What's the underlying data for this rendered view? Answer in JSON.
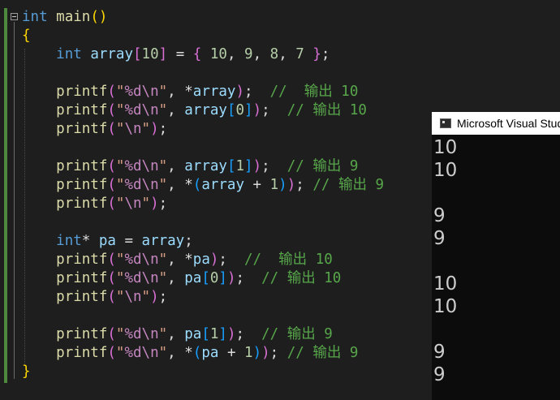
{
  "editor": {
    "code_lines": [
      [
        {
          "t": "int",
          "c": "kw"
        },
        {
          "t": " ",
          "c": "op"
        },
        {
          "t": "main",
          "c": "fn"
        },
        {
          "t": "()",
          "c": "p1"
        }
      ],
      [
        {
          "t": "{",
          "c": "p1"
        }
      ],
      [
        {
          "t": "    ",
          "c": "op"
        },
        {
          "t": "int",
          "c": "kw"
        },
        {
          "t": " ",
          "c": "op"
        },
        {
          "t": "array",
          "c": "var"
        },
        {
          "t": "[",
          "c": "p2"
        },
        {
          "t": "10",
          "c": "num"
        },
        {
          "t": "]",
          "c": "p2"
        },
        {
          "t": " = ",
          "c": "op"
        },
        {
          "t": "{",
          "c": "p2"
        },
        {
          "t": " ",
          "c": "op"
        },
        {
          "t": "10",
          "c": "num"
        },
        {
          "t": ", ",
          "c": "op"
        },
        {
          "t": "9",
          "c": "num"
        },
        {
          "t": ", ",
          "c": "op"
        },
        {
          "t": "8",
          "c": "num"
        },
        {
          "t": ", ",
          "c": "op"
        },
        {
          "t": "7",
          "c": "num"
        },
        {
          "t": " ",
          "c": "op"
        },
        {
          "t": "}",
          "c": "p2"
        },
        {
          "t": ";",
          "c": "op"
        }
      ],
      [],
      [
        {
          "t": "    ",
          "c": "op"
        },
        {
          "t": "printf",
          "c": "fn"
        },
        {
          "t": "(",
          "c": "p2"
        },
        {
          "t": "\"",
          "c": "str"
        },
        {
          "t": "%d",
          "c": "esc"
        },
        {
          "t": "\\n",
          "c": "esc"
        },
        {
          "t": "\"",
          "c": "str"
        },
        {
          "t": ", *",
          "c": "op"
        },
        {
          "t": "array",
          "c": "var"
        },
        {
          "t": ")",
          "c": "p2"
        },
        {
          "t": ";  ",
          "c": "op"
        },
        {
          "t": "//  输出 10",
          "c": "cmt"
        }
      ],
      [
        {
          "t": "    ",
          "c": "op"
        },
        {
          "t": "printf",
          "c": "fn"
        },
        {
          "t": "(",
          "c": "p2"
        },
        {
          "t": "\"",
          "c": "str"
        },
        {
          "t": "%d",
          "c": "esc"
        },
        {
          "t": "\\n",
          "c": "esc"
        },
        {
          "t": "\"",
          "c": "str"
        },
        {
          "t": ", ",
          "c": "op"
        },
        {
          "t": "array",
          "c": "var"
        },
        {
          "t": "[",
          "c": "p3"
        },
        {
          "t": "0",
          "c": "num"
        },
        {
          "t": "]",
          "c": "p3"
        },
        {
          "t": ")",
          "c": "p2"
        },
        {
          "t": ";  ",
          "c": "op"
        },
        {
          "t": "// 输出 10",
          "c": "cmt"
        }
      ],
      [
        {
          "t": "    ",
          "c": "op"
        },
        {
          "t": "printf",
          "c": "fn"
        },
        {
          "t": "(",
          "c": "p2"
        },
        {
          "t": "\"",
          "c": "str"
        },
        {
          "t": "\\n",
          "c": "esc"
        },
        {
          "t": "\"",
          "c": "str"
        },
        {
          "t": ")",
          "c": "p2"
        },
        {
          "t": ";",
          "c": "op"
        }
      ],
      [],
      [
        {
          "t": "    ",
          "c": "op"
        },
        {
          "t": "printf",
          "c": "fn"
        },
        {
          "t": "(",
          "c": "p2"
        },
        {
          "t": "\"",
          "c": "str"
        },
        {
          "t": "%d",
          "c": "esc"
        },
        {
          "t": "\\n",
          "c": "esc"
        },
        {
          "t": "\"",
          "c": "str"
        },
        {
          "t": ", ",
          "c": "op"
        },
        {
          "t": "array",
          "c": "var"
        },
        {
          "t": "[",
          "c": "p3"
        },
        {
          "t": "1",
          "c": "num"
        },
        {
          "t": "]",
          "c": "p3"
        },
        {
          "t": ")",
          "c": "p2"
        },
        {
          "t": ";  ",
          "c": "op"
        },
        {
          "t": "// 输出 9",
          "c": "cmt"
        }
      ],
      [
        {
          "t": "    ",
          "c": "op"
        },
        {
          "t": "printf",
          "c": "fn"
        },
        {
          "t": "(",
          "c": "p2"
        },
        {
          "t": "\"",
          "c": "str"
        },
        {
          "t": "%d",
          "c": "esc"
        },
        {
          "t": "\\n",
          "c": "esc"
        },
        {
          "t": "\"",
          "c": "str"
        },
        {
          "t": ", *",
          "c": "op"
        },
        {
          "t": "(",
          "c": "p3"
        },
        {
          "t": "array",
          "c": "var"
        },
        {
          "t": " + ",
          "c": "op"
        },
        {
          "t": "1",
          "c": "num"
        },
        {
          "t": ")",
          "c": "p3"
        },
        {
          "t": ")",
          "c": "p2"
        },
        {
          "t": "; ",
          "c": "op"
        },
        {
          "t": "// 输出 9",
          "c": "cmt"
        }
      ],
      [
        {
          "t": "    ",
          "c": "op"
        },
        {
          "t": "printf",
          "c": "fn"
        },
        {
          "t": "(",
          "c": "p2"
        },
        {
          "t": "\"",
          "c": "str"
        },
        {
          "t": "\\n",
          "c": "esc"
        },
        {
          "t": "\"",
          "c": "str"
        },
        {
          "t": ")",
          "c": "p2"
        },
        {
          "t": ";",
          "c": "op"
        }
      ],
      [],
      [
        {
          "t": "    ",
          "c": "op"
        },
        {
          "t": "int",
          "c": "kw"
        },
        {
          "t": "* ",
          "c": "op"
        },
        {
          "t": "pa",
          "c": "var"
        },
        {
          "t": " = ",
          "c": "op"
        },
        {
          "t": "array",
          "c": "var"
        },
        {
          "t": ";",
          "c": "op"
        }
      ],
      [
        {
          "t": "    ",
          "c": "op"
        },
        {
          "t": "printf",
          "c": "fn"
        },
        {
          "t": "(",
          "c": "p2"
        },
        {
          "t": "\"",
          "c": "str"
        },
        {
          "t": "%d",
          "c": "esc"
        },
        {
          "t": "\\n",
          "c": "esc"
        },
        {
          "t": "\"",
          "c": "str"
        },
        {
          "t": ", *",
          "c": "op"
        },
        {
          "t": "pa",
          "c": "var"
        },
        {
          "t": ")",
          "c": "p2"
        },
        {
          "t": ";  ",
          "c": "op"
        },
        {
          "t": "//  输出 10",
          "c": "cmt"
        }
      ],
      [
        {
          "t": "    ",
          "c": "op"
        },
        {
          "t": "printf",
          "c": "fn"
        },
        {
          "t": "(",
          "c": "p2"
        },
        {
          "t": "\"",
          "c": "str"
        },
        {
          "t": "%d",
          "c": "esc"
        },
        {
          "t": "\\n",
          "c": "esc"
        },
        {
          "t": "\"",
          "c": "str"
        },
        {
          "t": ", ",
          "c": "op"
        },
        {
          "t": "pa",
          "c": "var"
        },
        {
          "t": "[",
          "c": "p3"
        },
        {
          "t": "0",
          "c": "num"
        },
        {
          "t": "]",
          "c": "p3"
        },
        {
          "t": ")",
          "c": "p2"
        },
        {
          "t": ";  ",
          "c": "op"
        },
        {
          "t": "// 输出 10",
          "c": "cmt"
        }
      ],
      [
        {
          "t": "    ",
          "c": "op"
        },
        {
          "t": "printf",
          "c": "fn"
        },
        {
          "t": "(",
          "c": "p2"
        },
        {
          "t": "\"",
          "c": "str"
        },
        {
          "t": "\\n",
          "c": "esc"
        },
        {
          "t": "\"",
          "c": "str"
        },
        {
          "t": ")",
          "c": "p2"
        },
        {
          "t": ";",
          "c": "op"
        }
      ],
      [],
      [
        {
          "t": "    ",
          "c": "op"
        },
        {
          "t": "printf",
          "c": "fn"
        },
        {
          "t": "(",
          "c": "p2"
        },
        {
          "t": "\"",
          "c": "str"
        },
        {
          "t": "%d",
          "c": "esc"
        },
        {
          "t": "\\n",
          "c": "esc"
        },
        {
          "t": "\"",
          "c": "str"
        },
        {
          "t": ", ",
          "c": "op"
        },
        {
          "t": "pa",
          "c": "var"
        },
        {
          "t": "[",
          "c": "p3"
        },
        {
          "t": "1",
          "c": "num"
        },
        {
          "t": "]",
          "c": "p3"
        },
        {
          "t": ")",
          "c": "p2"
        },
        {
          "t": ";  ",
          "c": "op"
        },
        {
          "t": "// 输出 9",
          "c": "cmt"
        }
      ],
      [
        {
          "t": "    ",
          "c": "op"
        },
        {
          "t": "printf",
          "c": "fn"
        },
        {
          "t": "(",
          "c": "p2"
        },
        {
          "t": "\"",
          "c": "str"
        },
        {
          "t": "%d",
          "c": "esc"
        },
        {
          "t": "\\n",
          "c": "esc"
        },
        {
          "t": "\"",
          "c": "str"
        },
        {
          "t": ", *",
          "c": "op"
        },
        {
          "t": "(",
          "c": "p3"
        },
        {
          "t": "pa",
          "c": "var"
        },
        {
          "t": " + ",
          "c": "op"
        },
        {
          "t": "1",
          "c": "num"
        },
        {
          "t": ")",
          "c": "p3"
        },
        {
          "t": ")",
          "c": "p2"
        },
        {
          "t": "; ",
          "c": "op"
        },
        {
          "t": "// 输出 9",
          "c": "cmt"
        }
      ],
      [
        {
          "t": "}",
          "c": "p1"
        }
      ]
    ]
  },
  "console": {
    "icon": "console-app-icon",
    "title": "Microsoft Visual Studio",
    "output_lines": [
      "10",
      "10",
      "",
      "9",
      "9",
      "",
      "10",
      "10",
      "",
      "9",
      "9"
    ]
  },
  "colors": {
    "editor_bg": "#1e1e1e",
    "console_bg": "#0c0c0c",
    "keyword": "#569cd6",
    "function": "#dcdcaa",
    "variable": "#9cdcfe",
    "number": "#b5cea8",
    "string": "#d69d85",
    "escape": "#c586c0",
    "comment": "#57a64a"
  }
}
